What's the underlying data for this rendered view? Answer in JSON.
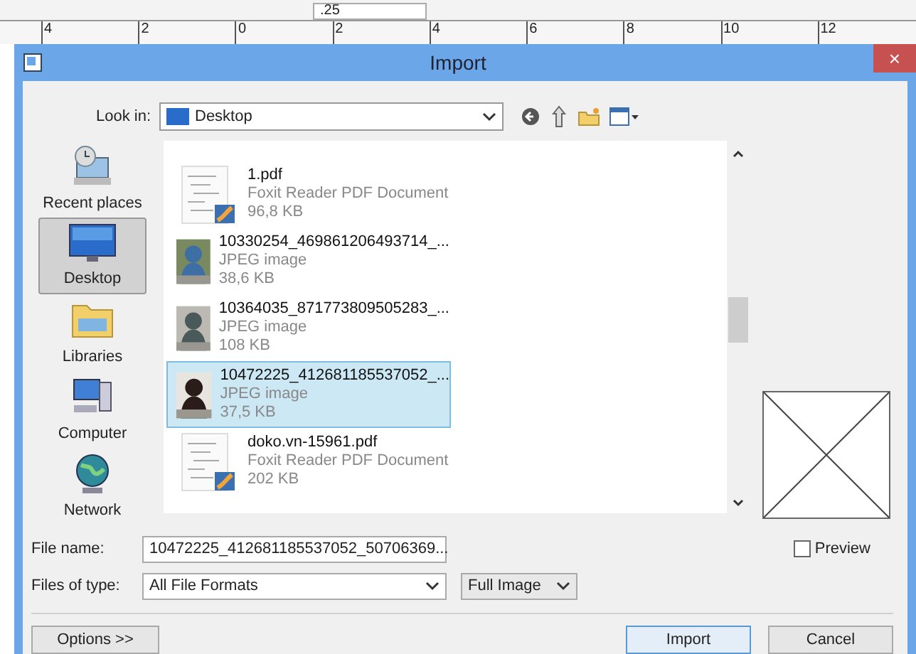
{
  "toolbar": {
    "field_value": ".25"
  },
  "ruler": {
    "labels": [
      "4",
      "2",
      "0",
      "2",
      "4",
      "6",
      "8",
      "10",
      "12"
    ]
  },
  "window": {
    "title": "Import",
    "close": "×"
  },
  "look_in": {
    "label": "Look in:",
    "value": "Desktop"
  },
  "places": [
    {
      "label": "Recent places",
      "kind": "recent",
      "selected": false
    },
    {
      "label": "Desktop",
      "kind": "desktop",
      "selected": true
    },
    {
      "label": "Libraries",
      "kind": "libraries",
      "selected": false
    },
    {
      "label": "Computer",
      "kind": "computer",
      "selected": false
    },
    {
      "label": "Network",
      "kind": "network",
      "selected": false
    }
  ],
  "files": [
    {
      "kind": "pdf",
      "name": "1.pdf",
      "type": "Foxit Reader PDF Document",
      "size": "96,8 KB",
      "selected": false
    },
    {
      "name": "10330254_469861206493714_...",
      "type": "JPEG image",
      "size": "38,6 KB",
      "selected": false
    },
    {
      "name": "10364035_871773809505283_...",
      "type": "JPEG image",
      "size": "108 KB",
      "selected": false
    },
    {
      "name": "10472225_412681185537052_...",
      "type": "JPEG image",
      "size": "37,5 KB",
      "selected": true
    },
    {
      "kind": "pdf",
      "name": "doko.vn-15961.pdf",
      "type": "Foxit Reader PDF Document",
      "size": "202 KB",
      "selected": false
    }
  ],
  "file_name": {
    "label": "File name:",
    "value": "10472225_412681185537052_50706369..."
  },
  "file_type": {
    "label": "Files of type:",
    "value": "All File Formats",
    "mode": "Full Image"
  },
  "preview": {
    "label": "Preview",
    "checked": false
  },
  "buttons": {
    "options": "Options >>",
    "import": "Import",
    "cancel": "Cancel"
  }
}
